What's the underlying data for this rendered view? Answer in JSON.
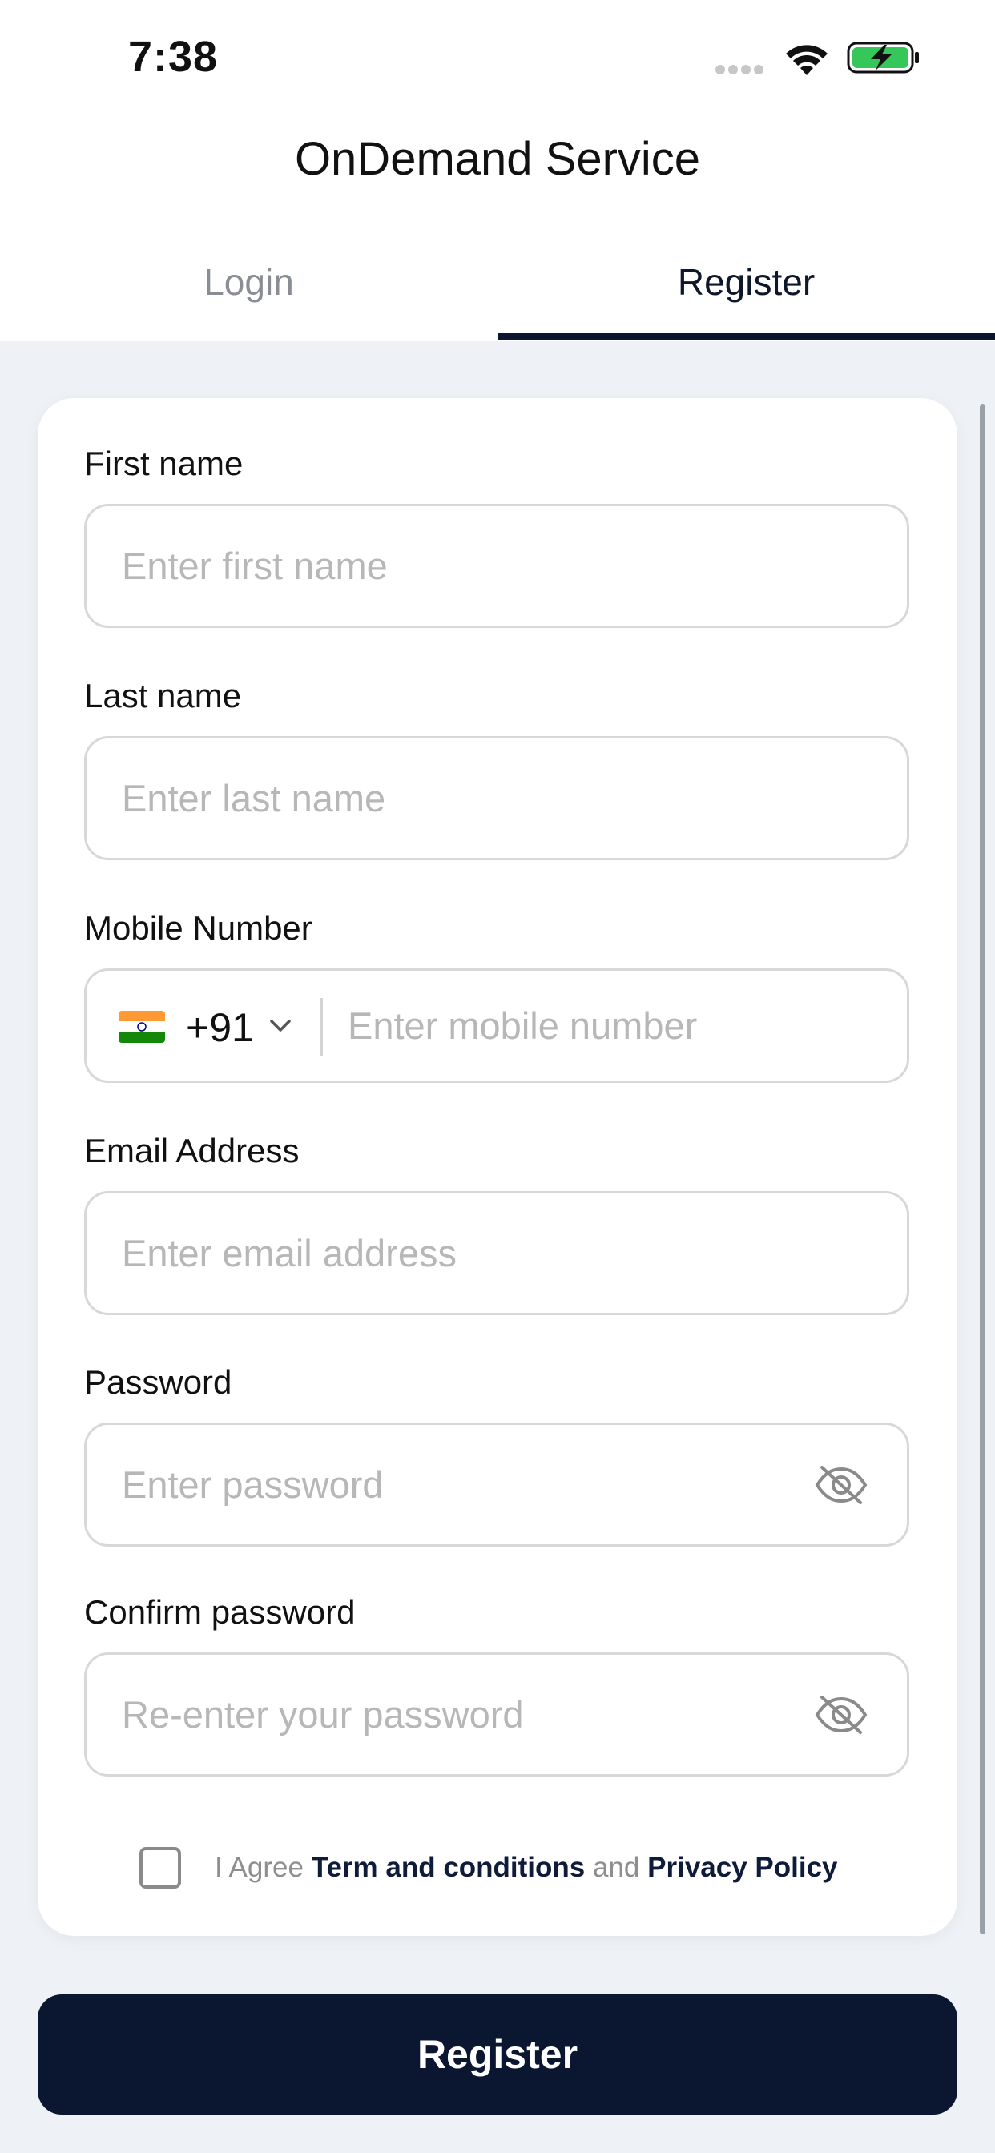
{
  "status_bar": {
    "time": "7:38"
  },
  "app": {
    "title": "OnDemand Service"
  },
  "tabs": [
    {
      "label": "Login",
      "active": false
    },
    {
      "label": "Register",
      "active": true
    }
  ],
  "form": {
    "first_name": {
      "label": "First name",
      "placeholder": "Enter first name",
      "value": ""
    },
    "last_name": {
      "label": "Last name",
      "placeholder": "Enter last name",
      "value": ""
    },
    "mobile": {
      "label": "Mobile Number",
      "country_code": "+91",
      "flag": "india-flag-icon",
      "placeholder": "Enter mobile number",
      "value": ""
    },
    "email": {
      "label": "Email Address",
      "placeholder": "Enter email address",
      "value": ""
    },
    "password": {
      "label": "Password",
      "placeholder": "Enter password",
      "value": "",
      "toggle_icon": "eye-off-icon"
    },
    "confirm_password": {
      "label": "Confirm password",
      "placeholder": "Re-enter your password",
      "value": "",
      "toggle_icon": "eye-off-icon"
    },
    "agree": {
      "checked": false,
      "prefix": "I Agree",
      "terms_link": "Term and conditions",
      "joiner": "and",
      "privacy_link": "Privacy Policy"
    }
  },
  "register_button": {
    "label": "Register"
  },
  "colors": {
    "primary": "#0b1730",
    "background": "#eef1f5",
    "card": "#ffffff",
    "placeholder": "#b7b7b7",
    "inactive_tab": "#8a8d93",
    "battery_green": "#35c759"
  }
}
